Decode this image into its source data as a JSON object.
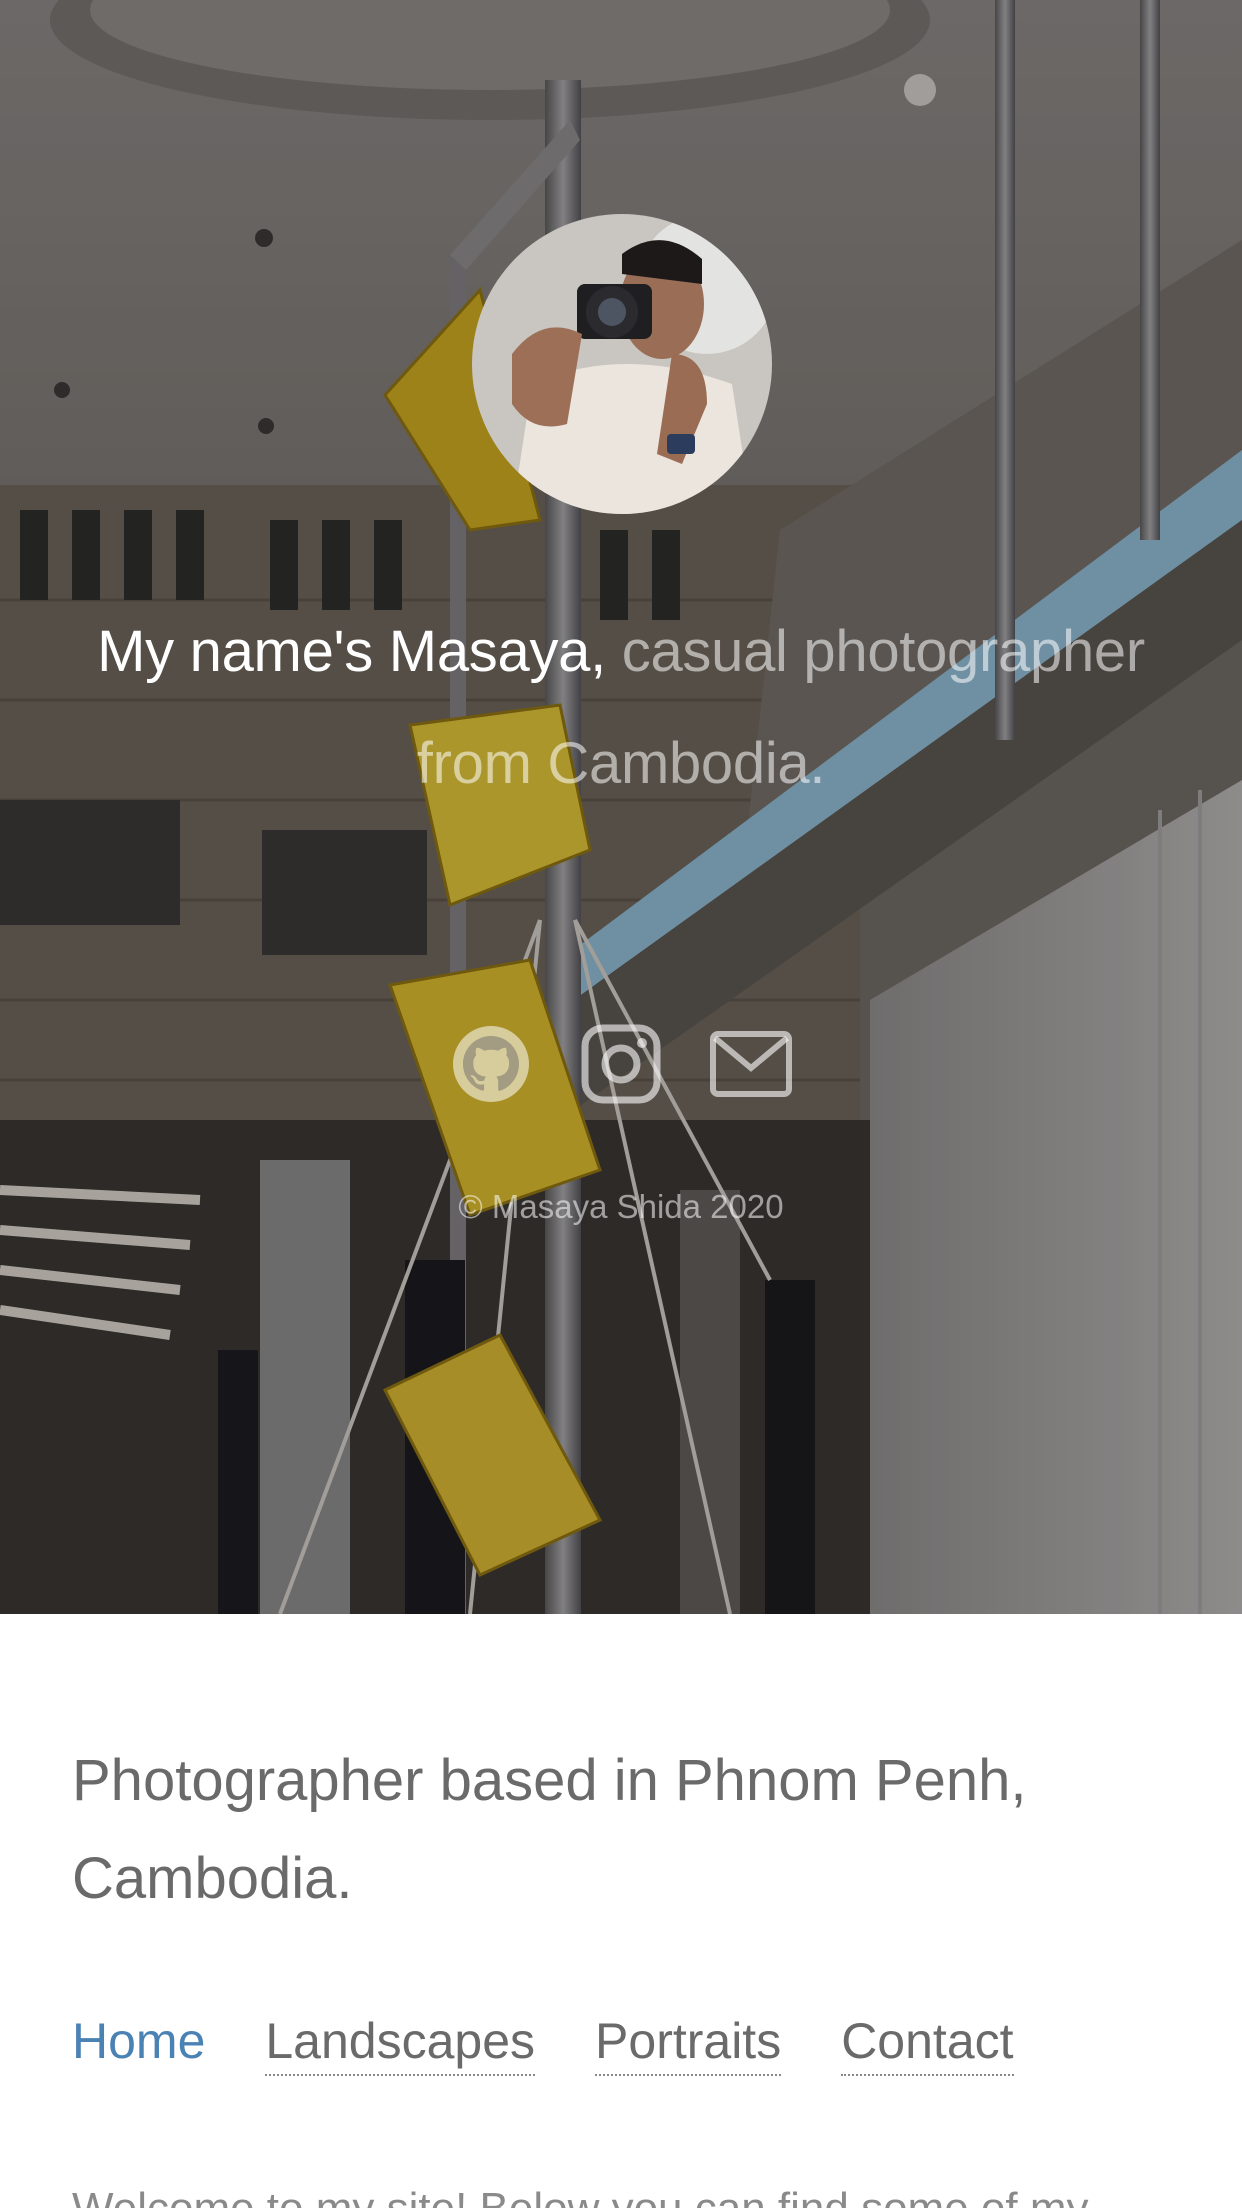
{
  "hero": {
    "intro_bright": "My name's Masaya,",
    "intro_dim_line1": "casual photographer",
    "intro_dim_line2": "from Cambodia.",
    "copyright": "© Masaya Shida 2020",
    "social": [
      {
        "icon": "github-icon"
      },
      {
        "icon": "instagram-icon"
      },
      {
        "icon": "mail-icon"
      }
    ]
  },
  "content": {
    "tagline": "Photographer based in Phnom Penh, Cambodia.",
    "nav": [
      "Home",
      "Landscapes",
      "Portraits",
      "Contact"
    ],
    "active_nav": "Home",
    "welcome": "Welcome to my site! Below you can find some of my"
  },
  "colors": {
    "link_active": "#4a82b4",
    "text": "#6a6a6a",
    "accent_yellow": "#d8b62a",
    "glass_blue": "#8fb8d0"
  }
}
